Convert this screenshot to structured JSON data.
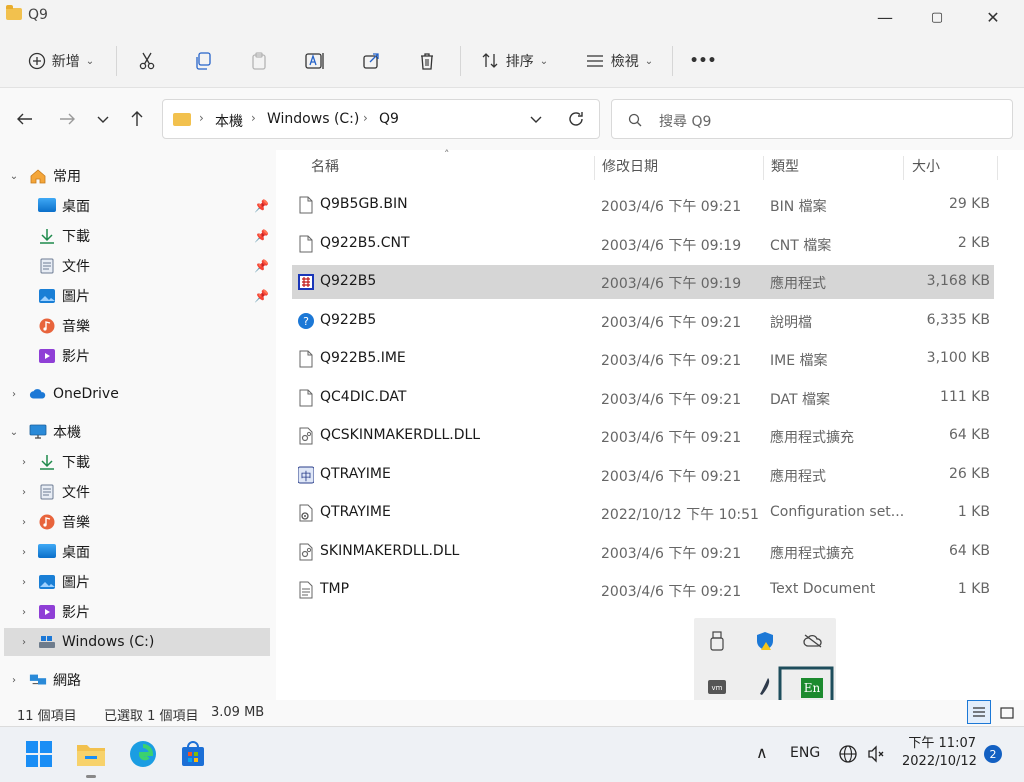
{
  "window": {
    "title": "Q9",
    "minimize": "—",
    "maximize": "▢",
    "close": "✕"
  },
  "toolbar": {
    "new_label": "新增",
    "sort_label": "排序",
    "view_label": "檢視",
    "more_label": "•••"
  },
  "address": {
    "crumbs": [
      "本機",
      "Windows (C:)",
      "Q9"
    ],
    "search_placeholder": "搜尋 Q9"
  },
  "columns": {
    "name": "名稱",
    "date": "修改日期",
    "type": "類型",
    "size": "大小"
  },
  "files": [
    {
      "name": "Q9B5GB.BIN",
      "date": "2003/4/6 下午 09:21",
      "type": "BIN 檔案",
      "size": "29 KB",
      "icon": "generic-file-icon"
    },
    {
      "name": "Q922B5.CNT",
      "date": "2003/4/6 下午 09:19",
      "type": "CNT 檔案",
      "size": "2 KB",
      "icon": "generic-file-icon"
    },
    {
      "name": "Q922B5",
      "date": "2003/4/6 下午 09:19",
      "type": "應用程式",
      "size": "3,168 KB",
      "icon": "q9-app-icon"
    },
    {
      "name": "Q922B5",
      "date": "2003/4/6 下午 09:21",
      "type": "說明檔",
      "size": "6,335 KB",
      "icon": "help-icon"
    },
    {
      "name": "Q922B5.IME",
      "date": "2003/4/6 下午 09:21",
      "type": "IME 檔案",
      "size": "3,100 KB",
      "icon": "generic-file-icon"
    },
    {
      "name": "QC4DIC.DAT",
      "date": "2003/4/6 下午 09:21",
      "type": "DAT 檔案",
      "size": "111 KB",
      "icon": "generic-file-icon"
    },
    {
      "name": "QCSKINMAKERDLL.DLL",
      "date": "2003/4/6 下午 09:21",
      "type": "應用程式擴充",
      "size": "64 KB",
      "icon": "dll-icon"
    },
    {
      "name": "QTRAYIME",
      "date": "2003/4/6 下午 09:21",
      "type": "應用程式",
      "size": "26 KB",
      "icon": "zhong-app-icon"
    },
    {
      "name": "QTRAYIME",
      "date": "2022/10/12 下午 10:51",
      "type": "Configuration set...",
      "size": "1 KB",
      "icon": "config-icon"
    },
    {
      "name": "SKINMAKERDLL.DLL",
      "date": "2003/4/6 下午 09:21",
      "type": "應用程式擴充",
      "size": "64 KB",
      "icon": "dll-icon"
    },
    {
      "name": "TMP",
      "date": "2003/4/6 下午 09:21",
      "type": "Text Document",
      "size": "1 KB",
      "icon": "text-file-icon"
    }
  ],
  "nav": {
    "quick_access": "常用",
    "quick_items": [
      "桌面",
      "下載",
      "文件",
      "圖片",
      "音樂",
      "影片"
    ],
    "onedrive": "OneDrive",
    "this_pc": "本機",
    "pc_items": [
      "下載",
      "文件",
      "音樂",
      "桌面",
      "圖片",
      "影片",
      "Windows (C:)"
    ],
    "network": "網路"
  },
  "status": {
    "count": "11 個項目",
    "selected": "已選取 1 個項目",
    "size": "3.09 MB"
  },
  "tray": {
    "en_label": "En",
    "lang": "ENG",
    "time": "下午 11:07",
    "date": "2022/10/12",
    "notify_count": "2",
    "chevron": "∧"
  },
  "colors": {
    "accent": "#0067c0",
    "selection": "#d6d6d6",
    "folder": "#f2c14e"
  }
}
